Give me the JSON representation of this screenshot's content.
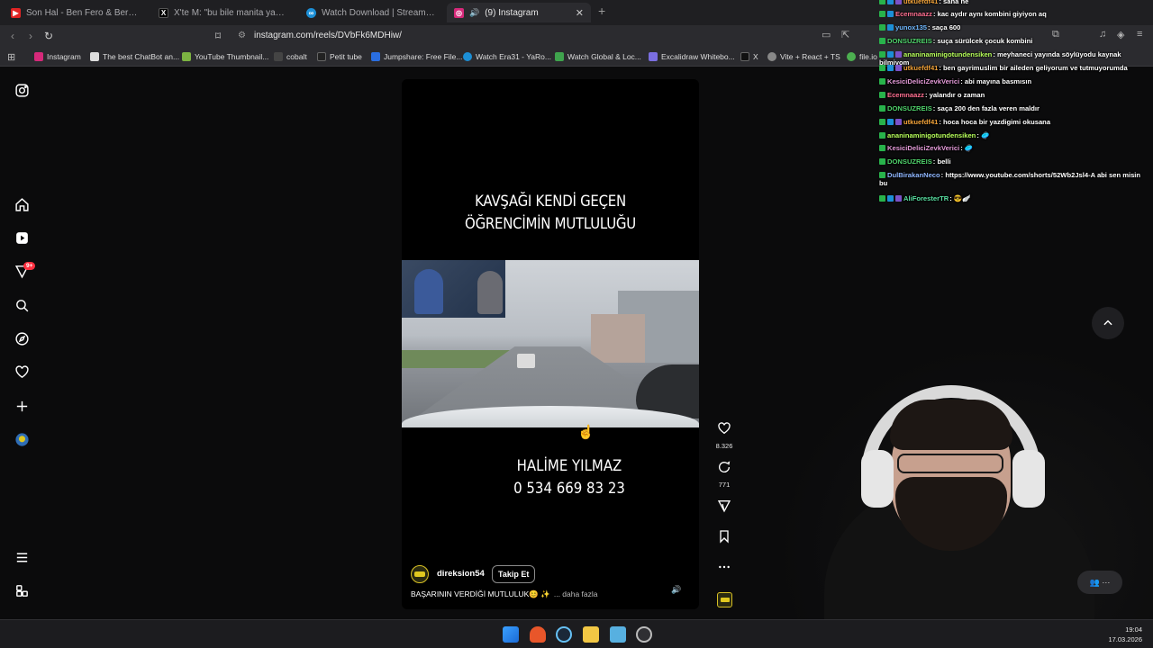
{
  "browser": {
    "tabs": [
      {
        "label": "Son Hal - Ben Fero & Berkcan Güven",
        "favicon": "youtube-icon",
        "color": "#e02424"
      },
      {
        "label": "X'te M: \"bu bile manita yapmış https:",
        "favicon": "x-icon",
        "color": "#000000"
      },
      {
        "label": "Watch Download | Streamable",
        "favicon": "streamable-icon",
        "color": "#1c8fd6"
      },
      {
        "label": "(9) Instagram",
        "favicon": "instagram-icon",
        "color": "#d6297a"
      }
    ],
    "url": "instagram.com/reels/DVbFk6MDHiw/",
    "bookmarks": [
      {
        "label": "Instagram",
        "color": "#d6297a"
      },
      {
        "label": "The best ChatBot an...",
        "color": "#dddddd"
      },
      {
        "label": "YouTube Thumbnail...",
        "color": "#7cb342"
      },
      {
        "label": "cobalt",
        "color": "#444444"
      },
      {
        "label": "Petit tube",
        "color": "#222222"
      },
      {
        "label": "Jumpshare: Free File...",
        "color": "#2a6ee0"
      },
      {
        "label": "Watch Era31 - YaRo...",
        "color": "#1c8fd6"
      },
      {
        "label": "Watch Global & Loc...",
        "color": "#3fa34d"
      },
      {
        "label": "Excalidraw Whitebo...",
        "color": "#7a6ee0"
      },
      {
        "label": "X",
        "color": "#111111"
      },
      {
        "label": "Vite + React + TS",
        "color": "#888888"
      },
      {
        "label": "file.io",
        "color": "#4caf50"
      }
    ]
  },
  "reel": {
    "title_line1": "KAVŞAĞI KENDİ GEÇEN",
    "title_line2": "ÖĞRENCİMİN MUTLULUĞU",
    "name": "HALİME YILMAZ",
    "phone": "0 534 669 83 23",
    "username": "direksion54",
    "follow": "Takip Et",
    "caption": "BAŞARININ VERDİĞİ MUTLULUK😊 ✨",
    "more": "... daha fazla",
    "likes": "8.326",
    "comments": "771"
  },
  "chat": [
    {
      "user": "utkuefdf41",
      "text": "sana ne",
      "badges": [
        "g",
        "t",
        "p"
      ],
      "color": "#f2a33a"
    },
    {
      "user": "Ecemnaazz",
      "text": "kac aydır aynı kombini giyiyon aq",
      "badges": [
        "g",
        "t"
      ],
      "color": "#ff6f91"
    },
    {
      "user": "yunox135",
      "text": "saça 600",
      "badges": [
        "g",
        "t"
      ],
      "color": "#6fb8ff"
    },
    {
      "user": "DONSUZREIS",
      "text": "suça sürülcek çocuk kombini",
      "badges": [
        "g"
      ],
      "color": "#4fd26b"
    },
    {
      "user": "ananinaminigotundensiken",
      "text": "meyhaneci yayında söylüyodu kaynak bilmiyom",
      "badges": [
        "g",
        "t",
        "p"
      ],
      "color": "#b7ff5a"
    },
    {
      "user": "utkuefdf41",
      "text": "ben gayrimuslim bir aileden geliyorum ve tutmuyorumda",
      "badges": [
        "g",
        "t",
        "p"
      ],
      "color": "#f2a33a"
    },
    {
      "user": "KesiciDeliciZevkVerici",
      "text": "abi mayına basmısın",
      "badges": [
        "g"
      ],
      "color": "#e39ad8"
    },
    {
      "user": "Ecemnaazz",
      "text": "yalandır o zaman",
      "badges": [
        "g"
      ],
      "color": "#ff6f91"
    },
    {
      "user": "DONSUZREIS",
      "text": "saça 200 den fazla veren maldır",
      "badges": [
        "g"
      ],
      "color": "#4fd26b"
    },
    {
      "user": "utkuefdf41",
      "text": "hoca hoca bir yazdigimi okusana",
      "badges": [
        "g",
        "t",
        "p"
      ],
      "color": "#f2a33a"
    },
    {
      "user": "ananinaminigotundensiken",
      "text": "🥏",
      "badges": [
        "g"
      ],
      "color": "#b7ff5a"
    },
    {
      "user": "KesiciDeliciZevkVerici",
      "text": "🥏",
      "badges": [
        "g"
      ],
      "color": "#e39ad8"
    },
    {
      "user": "DONSUZREIS",
      "text": "belli",
      "badges": [
        "g"
      ],
      "color": "#4fd26b"
    },
    {
      "user": "DulBirakanNeco",
      "text": "https://www.youtube.com/shorts/52Wb2Jsl4-A abi sen misin bu",
      "badges": [
        "g"
      ],
      "color": "#8fb6ff"
    },
    {
      "user": "AliForesterTR",
      "text": "😎🪽",
      "badges": [
        "g",
        "t",
        "p"
      ],
      "color": "#58e0a2"
    }
  ],
  "taskbar": {
    "time": "19:04",
    "date": "17.03.2026"
  },
  "colors": {
    "accent_notification": "#ff3040",
    "reel_bg": "#000000"
  }
}
